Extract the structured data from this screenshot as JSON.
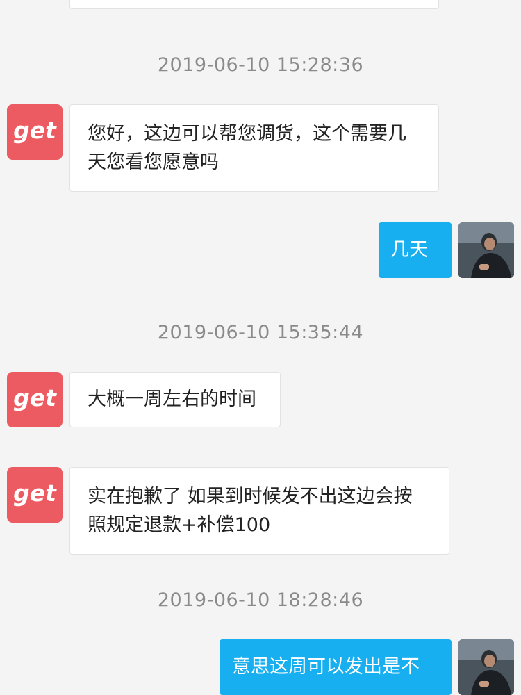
{
  "chat": {
    "bot_avatar_text": "get",
    "messages": [
      {
        "type": "timestamp",
        "text": "2019-06-10 15:28:36"
      },
      {
        "type": "incoming",
        "lines": [
          "您好，这边可以帮您调货，这个需要几",
          "天您看您愿意吗"
        ]
      },
      {
        "type": "outgoing",
        "text": "几天"
      },
      {
        "type": "timestamp",
        "text": "2019-06-10 15:35:44"
      },
      {
        "type": "incoming",
        "text": "大概一周左右的时间"
      },
      {
        "type": "incoming",
        "lines": [
          "实在抱歉了  如果到时候发不出这边会按",
          "照规定退款+补偿100"
        ]
      },
      {
        "type": "timestamp",
        "text": "2019-06-10 18:28:46"
      },
      {
        "type": "outgoing",
        "text": "意思这周可以发出是不"
      }
    ]
  },
  "colors": {
    "background": "#f4f4f4",
    "incoming_bubble": "#ffffff",
    "outgoing_bubble": "#17aff0",
    "bot_avatar": "#ec5a62",
    "timestamp_text": "#8a8a8a"
  },
  "icons": {
    "bot_avatar": "get-logo-icon",
    "user_avatar": "user-photo-avatar"
  }
}
